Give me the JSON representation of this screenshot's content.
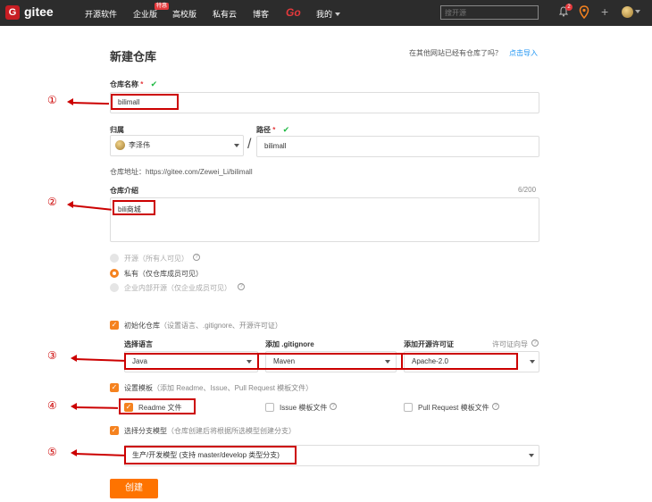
{
  "nav": {
    "logo_letter": "G",
    "logo_text": "gitee",
    "links": [
      "开源软件",
      "企业版",
      "高校版",
      "私有云",
      "博客"
    ],
    "hot_badge": "特惠",
    "go": "Go",
    "mine": "我的",
    "search_placeholder": "搜开源",
    "notification_count": "2",
    "plus": "+"
  },
  "page": {
    "title": "新建仓库",
    "import_prompt": "在其他网站已经有仓库了吗？",
    "import_link": "点击导入"
  },
  "form": {
    "repo_name_label": "仓库名称",
    "required_mark": "*",
    "check_mark": "✔",
    "repo_name_value": "bilimall",
    "owner_label": "归属",
    "owner_value": "李泽伟",
    "path_label": "路径",
    "path_value": "bilimall",
    "slash": "/",
    "repo_address": "仓库地址：https://gitee.com/Zewei_Li/bilimall",
    "desc_label": "仓库介绍",
    "desc_count": "6/200",
    "desc_value": "bili商城",
    "visibility": [
      {
        "label": "开源",
        "hint": "（所有人可见）",
        "selected": false
      },
      {
        "label": "私有",
        "hint": "（仅仓库成员可见）",
        "selected": true
      },
      {
        "label": "企业内部开源",
        "hint": "（仅企业成员可见）",
        "selected": false
      }
    ],
    "init_label": "初始化仓库",
    "init_hint": "（设置语言、.gitignore、开源许可证）",
    "lang_label": "选择语言",
    "gitignore_label": "添加 .gitignore",
    "license_label": "添加开源许可证",
    "license_wizard": "许可证向导",
    "lang_value": "Java",
    "gitignore_value": "Maven",
    "license_value": "Apache-2.0",
    "template_label": "设置模板",
    "template_hint": "（添加 Readme、Issue、Pull Request 模板文件）",
    "readme_label": "Readme 文件",
    "issue_label": "Issue 模板文件",
    "pr_label": "Pull Request 模板文件",
    "branch_label": "选择分支模型",
    "branch_hint": "（仓库创建后将根据所选模型创建分支）",
    "branch_value": "生产/开发模型 (支持 master/develop 类型分支)",
    "create_button": "创建"
  },
  "annotations": [
    "①",
    "②",
    "③",
    "④",
    "⑤"
  ],
  "colors": {
    "nav_bg": "#2c2c2c",
    "brand_red": "#c71d23",
    "accent_orange": "#fe7300",
    "annotation_red": "#cc0000",
    "link_blue": "#2196f3",
    "check_green": "#21ba45"
  },
  "icons": [
    "logo-icon",
    "bell-icon",
    "location-pin-icon",
    "plus-icon",
    "avatar",
    "chevron-down-icon",
    "question-icon",
    "checkmark-icon"
  ]
}
